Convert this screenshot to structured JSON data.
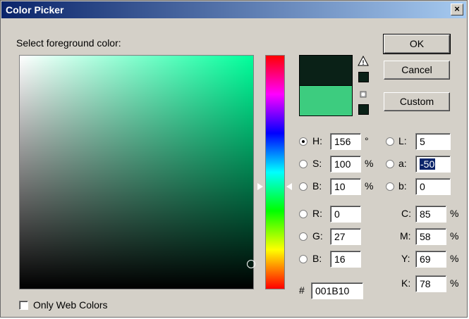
{
  "window": {
    "title": "Color Picker",
    "close_label": "×"
  },
  "prompt": "Select foreground color:",
  "buttons": {
    "ok": "OK",
    "cancel": "Cancel",
    "custom": "Custom"
  },
  "colors": {
    "new": "#0a2117",
    "current": "#3dcc7f",
    "gamut_swatch": "#0a2117",
    "web_swatch": "#0a2117"
  },
  "hsb": {
    "h_label": "H:",
    "h": "156",
    "h_unit": "°",
    "s_label": "S:",
    "s": "100",
    "s_unit": "%",
    "b_label": "B:",
    "b": "10",
    "b_unit": "%"
  },
  "rgb": {
    "r_label": "R:",
    "r": "0",
    "g_label": "G:",
    "g": "27",
    "b_label": "B:",
    "b": "16"
  },
  "lab": {
    "l_label": "L:",
    "l": "5",
    "a_label": "a:",
    "a": "-50",
    "b_label": "b:",
    "b": "0"
  },
  "cmyk": {
    "c_label": "C:",
    "c": "85",
    "m_label": "M:",
    "m": "58",
    "y_label": "Y:",
    "y": "69",
    "k_label": "K:",
    "k": "78",
    "unit": "%"
  },
  "hex": {
    "label": "#",
    "value": "001B10"
  },
  "web_colors": {
    "label": "Only Web Colors",
    "checked": false
  },
  "selected_model": "H"
}
